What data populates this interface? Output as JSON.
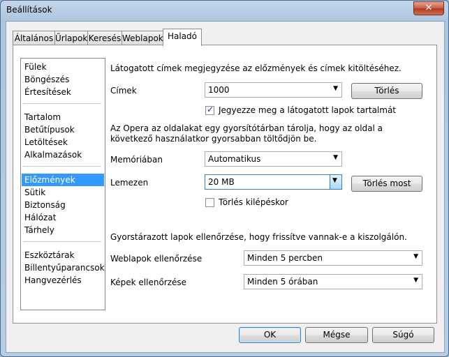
{
  "window": {
    "title": "Beállítások",
    "close_glyph": "✕"
  },
  "tabs": [
    "Általános",
    "Űrlapok",
    "Keresés",
    "Weblapok",
    "Haladó"
  ],
  "sidebar": {
    "items": [
      "Fülek",
      "Böngészés",
      "Értesítések",
      "Tartalom",
      "Betűtípusok",
      "Letöltések",
      "Alkalmazások",
      "Előzmények",
      "Sütik",
      "Biztonság",
      "Hálózat",
      "Tárhely",
      "Eszköztárak",
      "Billentyűparancsok",
      "Hangvezérlés"
    ],
    "selected": "Előzmények"
  },
  "history": {
    "intro": "Látogatott címek megjegyzése az előzmények és címek kitöltéséhez.",
    "addresses_label": "Címek",
    "addresses_value": "1000",
    "clear_label": "Törlés",
    "remember_content_label": "Jegyezze meg a látogatott lapok tartalmát",
    "remember_content_checked": true
  },
  "cache": {
    "intro_line1": "Az Opera az oldalakat egy gyorsítótárban tárolja, hogy az oldal a",
    "intro_line2": "következő használatkor gyorsabban töltődjön be.",
    "memory_label": "Memóriában",
    "memory_value": "Automatikus",
    "disk_label": "Lemezen",
    "disk_value": "20 MB",
    "clear_now_label": "Törlés most",
    "clear_on_exit_label": "Törlés kilépéskor",
    "clear_on_exit_checked": false
  },
  "check": {
    "intro": "Gyorstárazott lapok ellenőrzése, hogy frissítve vannak-e a kiszolgálón.",
    "pages_label": "Weblapok ellenőrzése",
    "pages_value": "Minden 5 percben",
    "images_label": "Képek ellenőrzése",
    "images_value": "Minden 5 órában"
  },
  "footer": {
    "ok": "OK",
    "cancel": "Mégse",
    "help": "Súgó"
  },
  "icons": {
    "dropdown": "▼",
    "check": "✓"
  }
}
